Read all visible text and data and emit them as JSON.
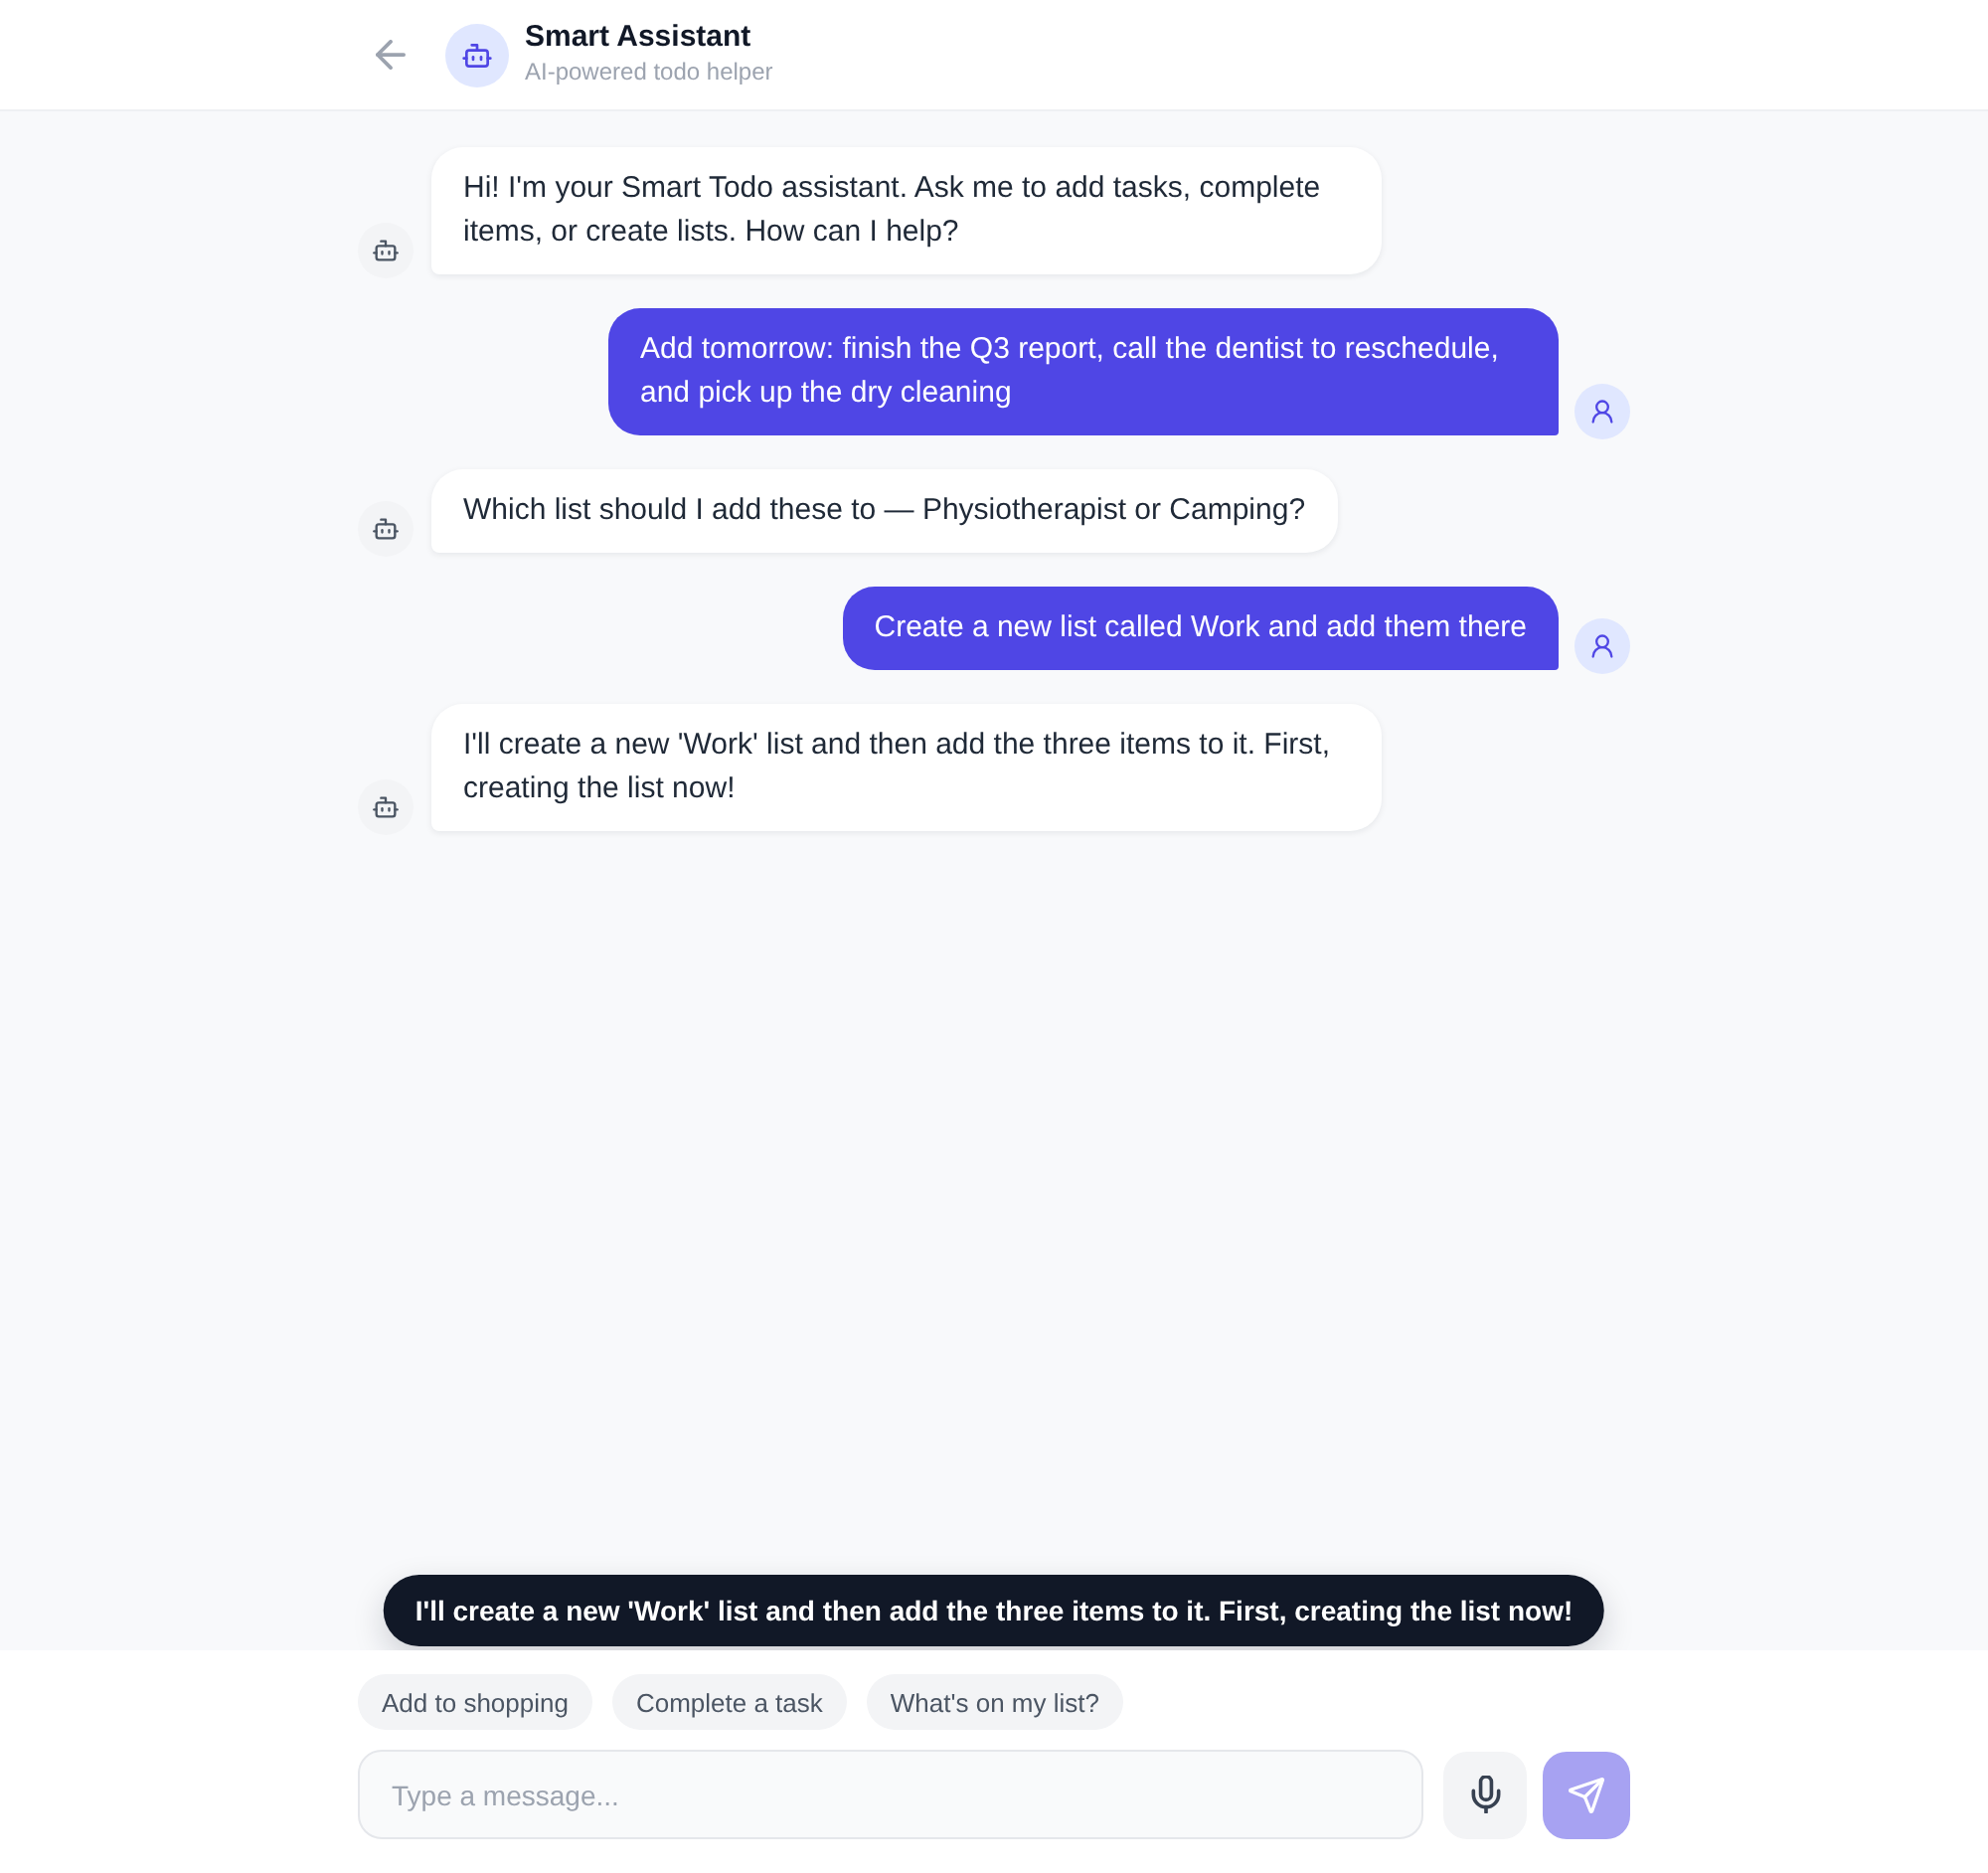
{
  "header": {
    "title": "Smart Assistant",
    "subtitle": "AI-powered todo helper"
  },
  "messages": [
    {
      "kind": "assistant",
      "text": "Hi! I'm your Smart Todo assistant. Ask me to add tasks, complete items, or create lists. How can I help?"
    },
    {
      "kind": "user",
      "text": "Add tomorrow: finish the Q3 report, call the dentist to reschedule, and pick up the dry cleaning"
    },
    {
      "kind": "assistant",
      "text": "Which list should I add these to — Physiotherapist or Camping?"
    },
    {
      "kind": "user",
      "text": "Create a new list called Work and add them there"
    },
    {
      "kind": "assistant",
      "text": "I'll create a new 'Work' list and then add the three items to it. First, creating the list now!"
    }
  ],
  "toast": {
    "text": "I'll create a new 'Work' list and then add the three items to it. First, creating the list now!"
  },
  "suggestions": [
    {
      "label": "Add to shopping"
    },
    {
      "label": "Complete a task"
    },
    {
      "label": "What's on my list?"
    }
  ],
  "composer": {
    "placeholder": "Type a message...",
    "send_disabled": true
  }
}
